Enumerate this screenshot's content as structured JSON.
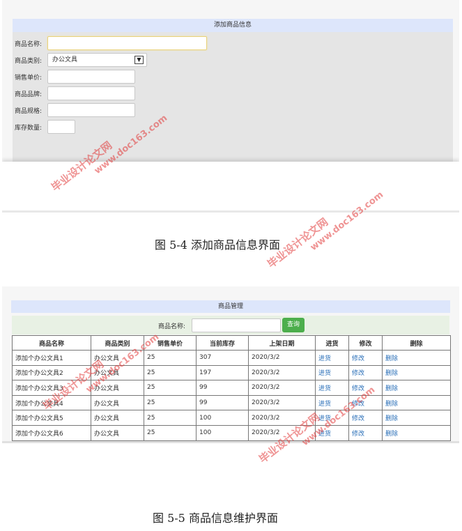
{
  "add_form": {
    "title": "添加商品信息",
    "fields": [
      {
        "label": "商品名称:",
        "type": "text",
        "value": ""
      },
      {
        "label": "商品类别:",
        "type": "select",
        "value": "办公文具"
      },
      {
        "label": "销售单价:",
        "type": "text",
        "value": ""
      },
      {
        "label": "商品品牌:",
        "type": "text",
        "value": ""
      },
      {
        "label": "商品规格:",
        "type": "text",
        "value": ""
      },
      {
        "label": "库存数量:",
        "type": "text",
        "value": ""
      }
    ],
    "select_arrow": "chevron-down-icon"
  },
  "caption1": "图 5-4 添加商品信息界面",
  "manage": {
    "title": "商品管理",
    "search_label": "商品名称:",
    "search_value": "",
    "search_button": "查询",
    "columns": [
      "商品名称",
      "商品类别",
      "销售单价",
      "当前库存",
      "上架日期",
      "进货",
      "修改",
      "删除"
    ],
    "rows": [
      [
        "添加个办公文具1",
        "办公文具",
        "25",
        "307",
        "2020/3/2",
        "进货",
        "修改",
        "删除"
      ],
      [
        "添加个办公文具2",
        "办公文具",
        "25",
        "197",
        "2020/3/2",
        "进货",
        "修改",
        "删除"
      ],
      [
        "添加个办公文具3",
        "办公文具",
        "25",
        "99",
        "2020/3/2",
        "进货",
        "修改",
        "删除"
      ],
      [
        "添加个办公文具4",
        "办公文具",
        "25",
        "99",
        "2020/3/2",
        "进货",
        "修改",
        "删除"
      ],
      [
        "添加个办公文具5",
        "办公文具",
        "25",
        "100",
        "2020/3/2",
        "进货",
        "修改",
        "删除"
      ],
      [
        "添加个办公文具6",
        "办公文具",
        "25",
        "100",
        "2020/3/2",
        "进货",
        "修改",
        "删除"
      ]
    ]
  },
  "caption2": "图 5-5 商品信息维护界面",
  "watermark": {
    "cn": "毕业设计论文网",
    "url": "www.doc163.com",
    "color": "#e13c3c"
  },
  "colors": {
    "title_bar": "#dde6fb",
    "form_bg": "#e5e5e5",
    "search_bg": "#e8f1e4",
    "button": "#4cae4c",
    "link": "#2a6fb8"
  }
}
